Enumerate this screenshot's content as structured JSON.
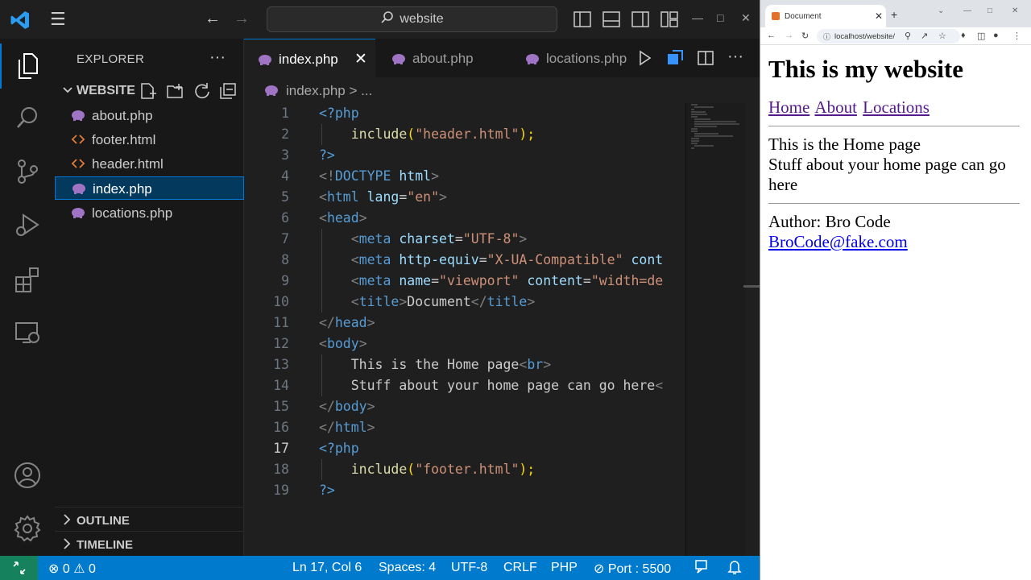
{
  "titlebar": {
    "search_text": "website"
  },
  "explorer": {
    "title": "EXPLORER",
    "more": "···",
    "folder": "WEBSITE",
    "files": [
      {
        "name": "about.php",
        "type": "php"
      },
      {
        "name": "footer.html",
        "type": "html"
      },
      {
        "name": "header.html",
        "type": "html"
      },
      {
        "name": "index.php",
        "type": "php",
        "selected": true
      },
      {
        "name": "locations.php",
        "type": "php"
      }
    ],
    "outline_label": "OUTLINE",
    "timeline_label": "TIMELINE"
  },
  "tabs": [
    {
      "label": "index.php",
      "active": true
    },
    {
      "label": "about.php"
    },
    {
      "label": "locations.php"
    }
  ],
  "breadcrumb": {
    "file": "index.php",
    "sep": ">",
    "rest": "..."
  },
  "editor": {
    "line_numbers": [
      "1",
      "2",
      "3",
      "4",
      "5",
      "6",
      "7",
      "8",
      "9",
      "10",
      "11",
      "12",
      "13",
      "14",
      "15",
      "16",
      "17",
      "18",
      "19"
    ],
    "current_line": 17,
    "code": {
      "l1": "<?php",
      "l2_fn": "include",
      "l2_open": "(",
      "l2_str": "\"header.html\"",
      "l2_close": ");",
      "l3": "?>",
      "l4_a": "<!",
      "l4_b": "DOCTYPE",
      "l4_c": " html",
      "l4_d": ">",
      "l5_a": "<",
      "l5_b": "html",
      "l5_c": " lang",
      "l5_d": "=",
      "l5_e": "\"en\"",
      "l5_f": ">",
      "l6_a": "<",
      "l6_b": "head",
      "l6_c": ">",
      "l7_a": "<",
      "l7_b": "meta",
      "l7_c": " charset",
      "l7_d": "=",
      "l7_e": "\"UTF-8\"",
      "l7_f": ">",
      "l8_a": "<",
      "l8_b": "meta",
      "l8_c": " http-equiv",
      "l8_d": "=",
      "l8_e": "\"X-UA-Compatible\"",
      "l8_f": " cont",
      "l9_a": "<",
      "l9_b": "meta",
      "l9_c": " name",
      "l9_d": "=",
      "l9_e": "\"viewport\"",
      "l9_f": " content",
      "l9_g": "=",
      "l9_h": "\"width=de",
      "l10_a": "<",
      "l10_b": "title",
      "l10_c": ">",
      "l10_d": "Document",
      "l10_e": "</",
      "l10_f": "title",
      "l10_g": ">",
      "l11_a": "</",
      "l11_b": "head",
      "l11_c": ">",
      "l12_a": "<",
      "l12_b": "body",
      "l12_c": ">",
      "l13_a": "This is the Home page",
      "l13_b": "<",
      "l13_c": "br",
      "l13_d": ">",
      "l14_a": "Stuff about your home page can go here",
      "l14_b": "<",
      "l15_a": "</",
      "l15_b": "body",
      "l15_c": ">",
      "l16_a": "</",
      "l16_b": "html",
      "l16_c": ">",
      "l17": "<?php",
      "l18_fn": "include",
      "l18_open": "(",
      "l18_str": "\"footer.html\"",
      "l18_close": ");",
      "l19": "?>"
    }
  },
  "statusbar": {
    "errors": "0",
    "warnings": "0",
    "position": "Ln 17, Col 6",
    "spaces": "Spaces: 4",
    "encoding": "UTF-8",
    "eol": "CRLF",
    "language": "PHP",
    "port": "Port : 5500"
  },
  "browser": {
    "tab_title": "Document",
    "url": "localhost/website/",
    "page": {
      "heading": "This is my website",
      "nav": [
        "Home",
        "About",
        "Locations"
      ],
      "line1": "This is the Home page",
      "line2": "Stuff about your home page can go here",
      "author": "Author: Bro Code",
      "email": "BroCode@fake.com"
    }
  },
  "colors": {
    "accent": "#0078d4",
    "statusbar": "#007acc",
    "remote": "#16825d",
    "php_icon": "#a074c4",
    "html_icon": "#e37933"
  }
}
